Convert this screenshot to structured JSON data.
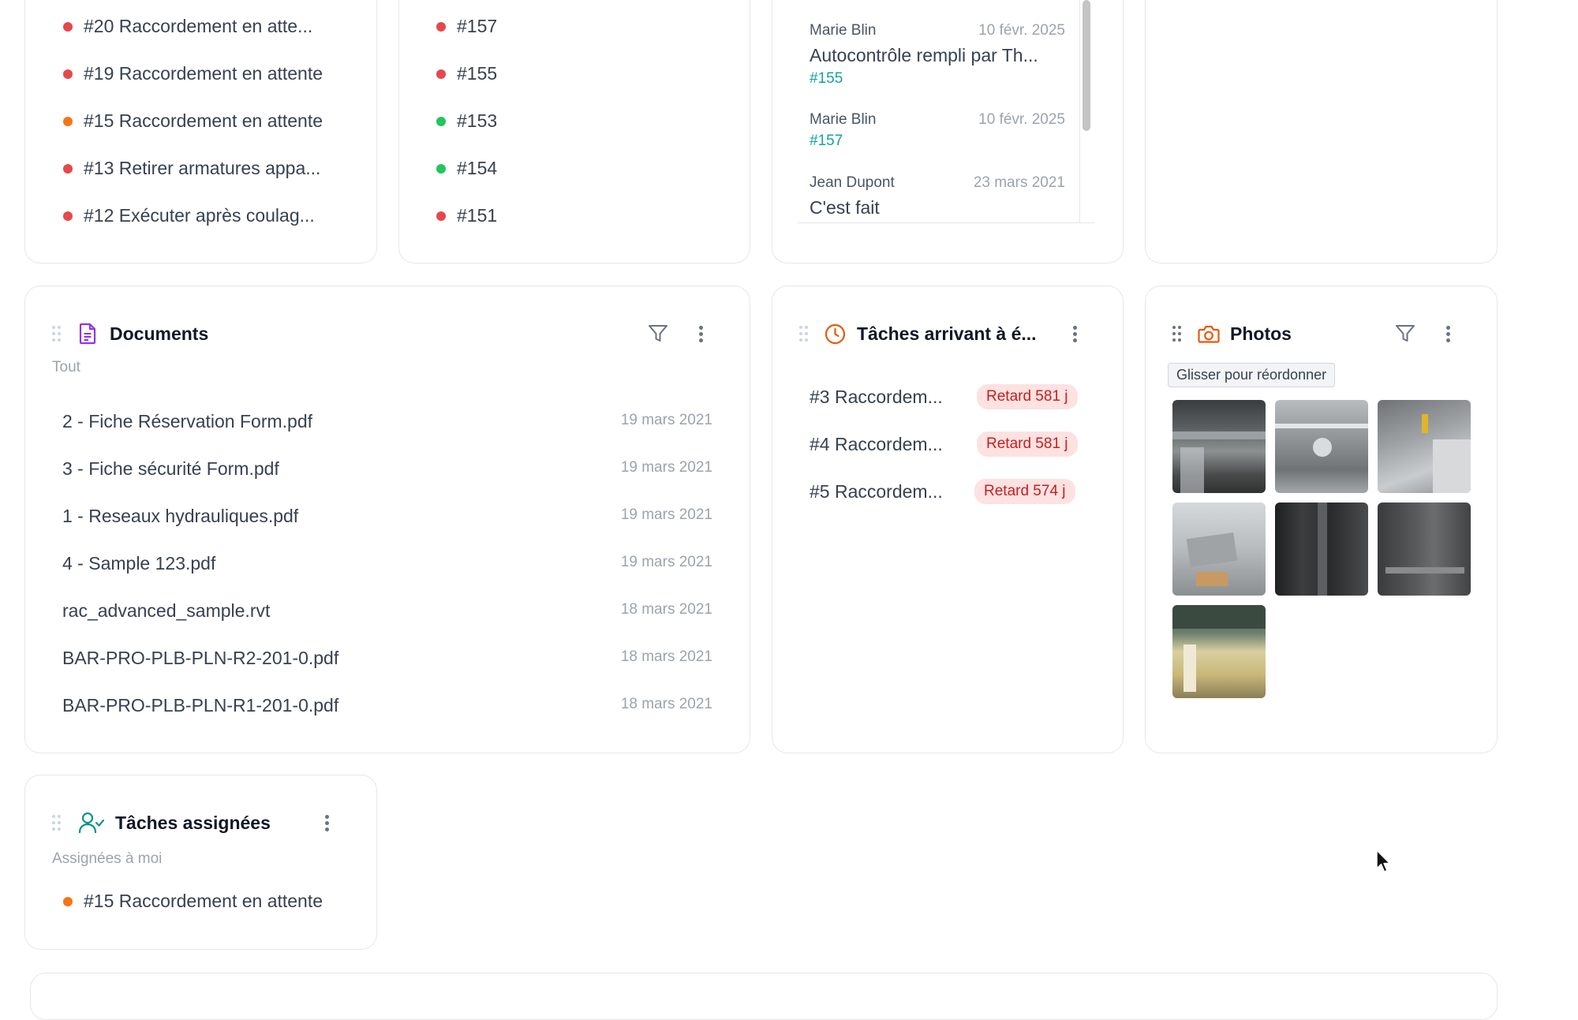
{
  "tasks_list": {
    "items": [
      {
        "label": "#20 Raccordement en atte...",
        "status": "red"
      },
      {
        "label": "#19 Raccordement en attente",
        "status": "red"
      },
      {
        "label": "#15 Raccordement en attente",
        "status": "orange"
      },
      {
        "label": "#13 Retirer armatures appa...",
        "status": "red"
      },
      {
        "label": "#12 Exécuter après coulag...",
        "status": "red"
      }
    ]
  },
  "forms_list": {
    "items": [
      {
        "label": "#157",
        "status": "red"
      },
      {
        "label": "#155",
        "status": "red"
      },
      {
        "label": "#153",
        "status": "green"
      },
      {
        "label": "#154",
        "status": "green"
      },
      {
        "label": "#151",
        "status": "red"
      }
    ]
  },
  "comments": {
    "items": [
      {
        "author": "Marie Blin",
        "date": "10 févr. 2025",
        "text": "Autocontrôle rempli par Th...",
        "ref": "#155"
      },
      {
        "author": "Marie Blin",
        "date": "10 févr. 2025",
        "text": "",
        "ref": "#157"
      },
      {
        "author": "Jean Dupont",
        "date": "23 mars 2021",
        "text": "C'est fait",
        "ref": ""
      }
    ]
  },
  "documents": {
    "title": "Documents",
    "filter": "Tout",
    "items": [
      {
        "name": "2 - Fiche Réservation Form.pdf",
        "date": "19 mars 2021"
      },
      {
        "name": "3 - Fiche sécurité Form.pdf",
        "date": "19 mars 2021"
      },
      {
        "name": "1 - Reseaux hydrauliques.pdf",
        "date": "19 mars 2021"
      },
      {
        "name": "4 - Sample 123.pdf",
        "date": "19 mars 2021"
      },
      {
        "name": "rac_advanced_sample.rvt",
        "date": "18 mars 2021"
      },
      {
        "name": "BAR-PRO-PLB-PLN-R2-201-0.pdf",
        "date": "18 mars 2021"
      },
      {
        "name": "BAR-PRO-PLB-PLN-R1-201-0.pdf",
        "date": "18 mars 2021"
      }
    ]
  },
  "due_tasks": {
    "title": "Tâches arrivant à é...",
    "items": [
      {
        "label": "#3 Raccordem...",
        "badge": "Retard 581 j"
      },
      {
        "label": "#4 Raccordem...",
        "badge": "Retard 581 j"
      },
      {
        "label": "#5 Raccordem...",
        "badge": "Retard 574 j"
      }
    ]
  },
  "photos": {
    "title": "Photos",
    "tooltip": "Glisser pour réordonner",
    "count": 7
  },
  "assigned": {
    "title": "Tâches assignées",
    "filter": "Assignées à moi",
    "items": [
      {
        "label": "#15 Raccordement en attente",
        "status": "orange"
      }
    ]
  },
  "colors": {
    "red": "#e5484d",
    "green": "#22c55e",
    "orange": "#f97316",
    "documents_icon": "#9333ea",
    "due_icon": "#ea580c",
    "photos_icon": "#ea580c",
    "assigned_icon": "#0d9488",
    "link": "#14a39a"
  }
}
